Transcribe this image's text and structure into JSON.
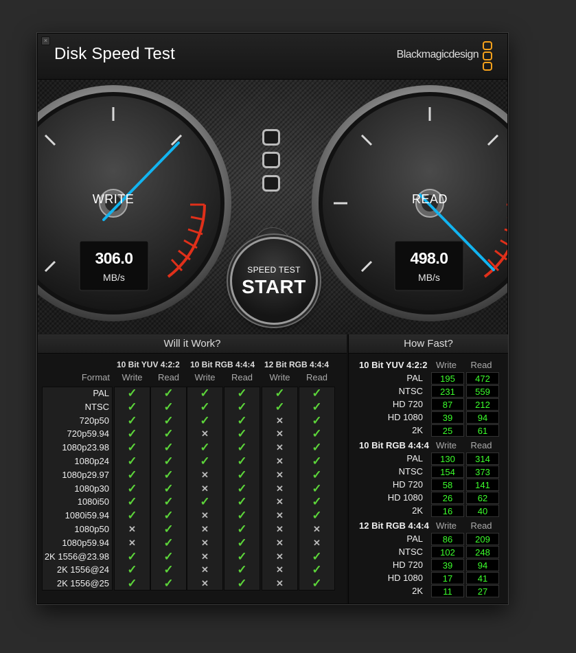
{
  "window": {
    "title": "Disk Speed Test",
    "brand": "Blackmagicdesign",
    "close_icon": "close-icon"
  },
  "gauges": {
    "write": {
      "label": "WRITE",
      "value": "306.0",
      "unit": "MB/s"
    },
    "read": {
      "label": "READ",
      "value": "498.0",
      "unit": "MB/s"
    }
  },
  "start_button": {
    "line1": "SPEED TEST",
    "line2": "START"
  },
  "colors": {
    "needle": "#12b4f0",
    "check": "#5cd43a",
    "speed_text": "#3cff2c",
    "redline": "#e0301a"
  },
  "will_it_work": {
    "title": "Will it Work?",
    "format_header": "Format",
    "groups": [
      "10 Bit YUV 4:2:2",
      "10 Bit RGB 4:4:4",
      "12 Bit RGB 4:4:4"
    ],
    "subheaders": [
      "Write",
      "Read",
      "Write",
      "Read",
      "Write",
      "Read"
    ],
    "rows": [
      {
        "format": "PAL",
        "marks": [
          1,
          1,
          1,
          1,
          1,
          1
        ]
      },
      {
        "format": "NTSC",
        "marks": [
          1,
          1,
          1,
          1,
          1,
          1
        ]
      },
      {
        "format": "720p50",
        "marks": [
          1,
          1,
          1,
          1,
          0,
          1
        ]
      },
      {
        "format": "720p59.94",
        "marks": [
          1,
          1,
          0,
          1,
          0,
          1
        ]
      },
      {
        "format": "1080p23.98",
        "marks": [
          1,
          1,
          1,
          1,
          0,
          1
        ]
      },
      {
        "format": "1080p24",
        "marks": [
          1,
          1,
          1,
          1,
          0,
          1
        ]
      },
      {
        "format": "1080p29.97",
        "marks": [
          1,
          1,
          0,
          1,
          0,
          1
        ]
      },
      {
        "format": "1080p30",
        "marks": [
          1,
          1,
          0,
          1,
          0,
          1
        ]
      },
      {
        "format": "1080i50",
        "marks": [
          1,
          1,
          1,
          1,
          0,
          1
        ]
      },
      {
        "format": "1080i59.94",
        "marks": [
          1,
          1,
          0,
          1,
          0,
          1
        ]
      },
      {
        "format": "1080p50",
        "marks": [
          0,
          1,
          0,
          1,
          0,
          0
        ]
      },
      {
        "format": "1080p59.94",
        "marks": [
          0,
          1,
          0,
          1,
          0,
          0
        ]
      },
      {
        "format": "2K 1556@23.98",
        "marks": [
          1,
          1,
          0,
          1,
          0,
          1
        ]
      },
      {
        "format": "2K 1556@24",
        "marks": [
          1,
          1,
          0,
          1,
          0,
          1
        ]
      },
      {
        "format": "2K 1556@25",
        "marks": [
          1,
          1,
          0,
          1,
          0,
          1
        ]
      }
    ]
  },
  "how_fast": {
    "title": "How Fast?",
    "sections": [
      {
        "name": "10 Bit YUV 4:2:2",
        "write_label": "Write",
        "read_label": "Read",
        "rows": [
          {
            "format": "PAL",
            "write": "195",
            "read": "472"
          },
          {
            "format": "NTSC",
            "write": "231",
            "read": "559"
          },
          {
            "format": "HD 720",
            "write": "87",
            "read": "212"
          },
          {
            "format": "HD 1080",
            "write": "39",
            "read": "94"
          },
          {
            "format": "2K",
            "write": "25",
            "read": "61"
          }
        ]
      },
      {
        "name": "10 Bit RGB 4:4:4",
        "write_label": "Write",
        "read_label": "Read",
        "rows": [
          {
            "format": "PAL",
            "write": "130",
            "read": "314"
          },
          {
            "format": "NTSC",
            "write": "154",
            "read": "373"
          },
          {
            "format": "HD 720",
            "write": "58",
            "read": "141"
          },
          {
            "format": "HD 1080",
            "write": "26",
            "read": "62"
          },
          {
            "format": "2K",
            "write": "16",
            "read": "40"
          }
        ]
      },
      {
        "name": "12 Bit RGB 4:4:4",
        "write_label": "Write",
        "read_label": "Read",
        "rows": [
          {
            "format": "PAL",
            "write": "86",
            "read": "209"
          },
          {
            "format": "NTSC",
            "write": "102",
            "read": "248"
          },
          {
            "format": "HD 720",
            "write": "39",
            "read": "94"
          },
          {
            "format": "HD 1080",
            "write": "17",
            "read": "41"
          },
          {
            "format": "2K",
            "write": "11",
            "read": "27"
          }
        ]
      }
    ]
  }
}
